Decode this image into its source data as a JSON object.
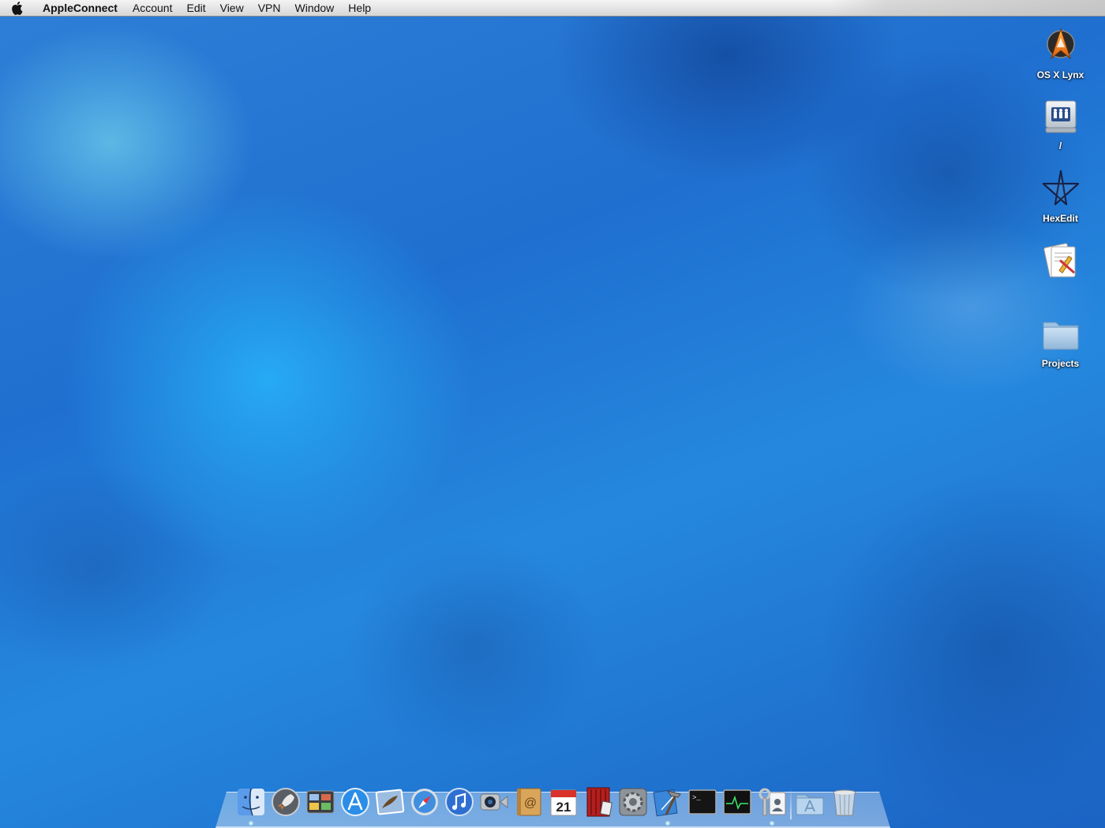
{
  "menubar": {
    "app_name": "AppleConnect",
    "items": [
      "Account",
      "Edit",
      "View",
      "VPN",
      "Window",
      "Help"
    ]
  },
  "desktop_icons": [
    {
      "label": "OS X Lynx",
      "icon": "os-x-lynx-app-icon"
    },
    {
      "label": "/",
      "icon": "server-volume-icon"
    },
    {
      "label": "HexEdit",
      "icon": "hexedit-pentagram-icon"
    },
    {
      "label": "",
      "icon": "script-document-icon"
    },
    {
      "label": "Projects",
      "icon": "folder-icon"
    }
  ],
  "dock": {
    "items": [
      {
        "name": "Finder",
        "icon": "finder-icon",
        "running": true
      },
      {
        "name": "Launchpad",
        "icon": "launchpad-icon",
        "running": false
      },
      {
        "name": "Mission Control",
        "icon": "mission-control-icon",
        "running": false
      },
      {
        "name": "App Store",
        "icon": "app-store-icon",
        "running": false
      },
      {
        "name": "Mail",
        "icon": "mail-icon",
        "running": false
      },
      {
        "name": "Safari",
        "icon": "safari-icon",
        "running": false
      },
      {
        "name": "iTunes",
        "icon": "itunes-icon",
        "running": false
      },
      {
        "name": "FaceTime",
        "icon": "facetime-icon",
        "running": false
      },
      {
        "name": "Address Book",
        "icon": "address-book-icon",
        "running": false
      },
      {
        "name": "iCal",
        "icon": "ical-icon",
        "running": false,
        "date": "21"
      },
      {
        "name": "Photo Booth",
        "icon": "photo-booth-icon",
        "running": false
      },
      {
        "name": "System Preferences",
        "icon": "system-preferences-icon",
        "running": false
      },
      {
        "name": "Xcode",
        "icon": "xcode-icon",
        "running": true
      },
      {
        "name": "Terminal",
        "icon": "terminal-icon",
        "running": false,
        "prompt": ">_"
      },
      {
        "name": "Activity Monitor",
        "icon": "activity-monitor-icon",
        "running": false
      },
      {
        "name": "AppleConnect",
        "icon": "appleconnect-badge-icon",
        "running": true
      }
    ],
    "stacks": [
      {
        "name": "Applications",
        "icon": "applications-folder-icon"
      },
      {
        "name": "Trash",
        "icon": "trash-icon"
      }
    ]
  }
}
